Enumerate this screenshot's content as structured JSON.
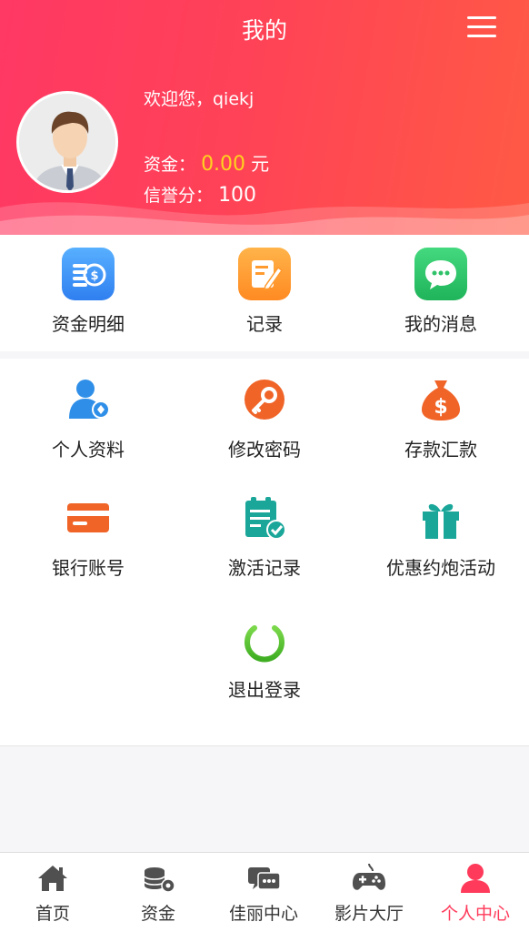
{
  "header": {
    "title": "我的",
    "welcome": "欢迎您，qiekj",
    "funds_label": "资金：",
    "funds_amount": "0.00",
    "funds_unit": "元",
    "credit_label": "信誉分：",
    "credit_score": "100"
  },
  "quick_actions": [
    {
      "label": "资金明细",
      "icon": "coins-icon",
      "color": "#3d8ef5"
    },
    {
      "label": "记录",
      "icon": "note-edit-icon",
      "color": "#ff9a2e"
    },
    {
      "label": "我的消息",
      "icon": "chat-bubble-icon",
      "color": "#2fc268"
    }
  ],
  "menu_items": [
    {
      "label": "个人资料",
      "icon": "user-profile-icon",
      "color": "#2f8fe8"
    },
    {
      "label": "修改密码",
      "icon": "key-icon",
      "color": "#f06428"
    },
    {
      "label": "存款汇款",
      "icon": "money-bag-icon",
      "color": "#f06428"
    },
    {
      "label": "银行账号",
      "icon": "bank-card-icon",
      "color": "#f06428"
    },
    {
      "label": "激活记录",
      "icon": "clipboard-check-icon",
      "color": "#1aa79a"
    },
    {
      "label": "优惠约炮活动",
      "icon": "gift-icon",
      "color": "#1aa79a"
    },
    {
      "label": "退出登录",
      "icon": "power-icon",
      "color": "#56c230"
    }
  ],
  "tabbar": [
    {
      "label": "首页",
      "icon": "home-icon"
    },
    {
      "label": "资金",
      "icon": "coins-gear-icon"
    },
    {
      "label": "佳丽中心",
      "icon": "chat-icon"
    },
    {
      "label": "影片大厅",
      "icon": "gamepad-icon"
    },
    {
      "label": "个人中心",
      "icon": "person-icon",
      "active": true
    }
  ],
  "colors": {
    "header_gradient_start": "#ff3864",
    "header_gradient_end": "#ff5a45",
    "funds_amount": "#ffd21e",
    "active_tab": "#ff3a5a"
  }
}
